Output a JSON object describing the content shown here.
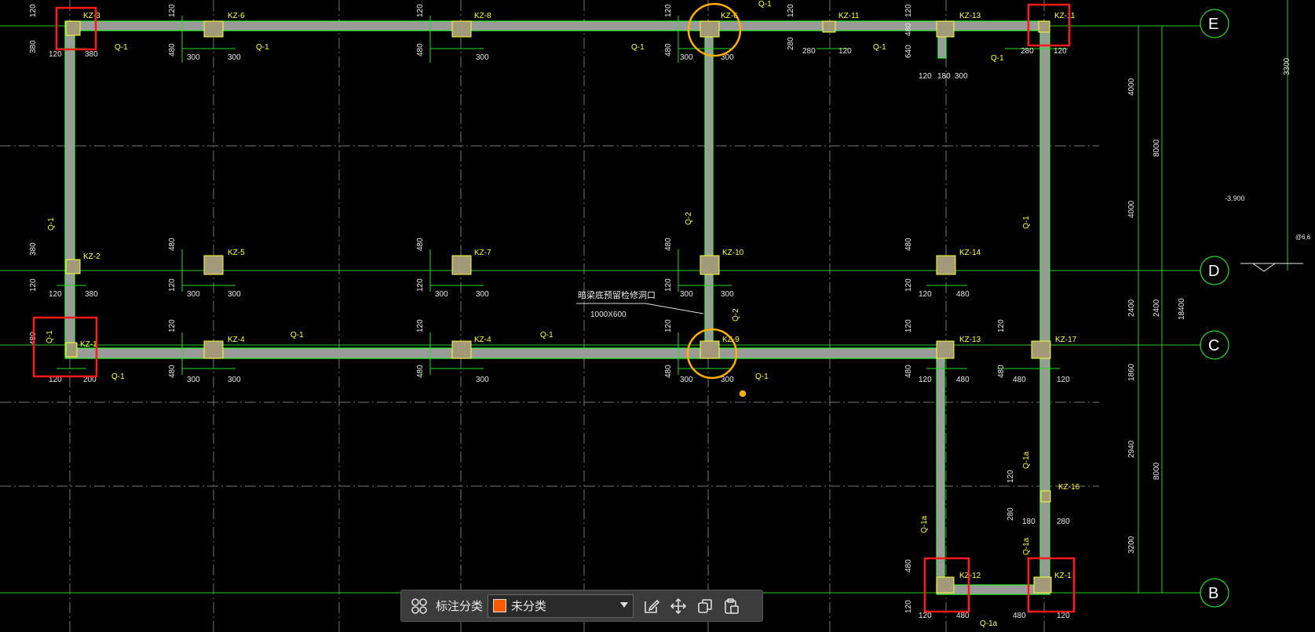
{
  "colors": {
    "background": "#000000",
    "wall": "#9a9a9a",
    "wall_edge": "#33ff33",
    "axis": "#ffffff",
    "dimension": "#22dd22",
    "label": "#ffff33",
    "column_fill": "#a39a7a",
    "highlight_red": "#ff1a1a",
    "highlight_orange": "#ffb000",
    "category_swatch": "#ff5a00"
  },
  "axes": {
    "E": "E",
    "D": "D",
    "C": "C",
    "B": "B"
  },
  "columns": {
    "kz1": "KZ-1",
    "kz2": "KZ-2",
    "kz3": "KZ-3",
    "kz4a": "KZ-4",
    "kz4b": "KZ-4",
    "kz5": "KZ-5",
    "kz6a": "KZ-6",
    "kz6b": "KZ-6",
    "kz7": "KZ-7",
    "kz8": "KZ-8",
    "kz9": "KZ-9",
    "kz10": "KZ-10",
    "kz11a": "KZ-11",
    "kz11b": "KZ-11",
    "kz12": "KZ-12",
    "kz13a": "KZ-13",
    "kz13b": "KZ-13",
    "kz14": "KZ-14",
    "kz16": "KZ-16",
    "kz17": "KZ-17",
    "kz1x": "KZ-1"
  },
  "walls": {
    "q1": "Q-1",
    "q2": "Q-2",
    "q1a": "Q-1a"
  },
  "dims": {
    "d120": "120",
    "d380": "380",
    "d480": "480",
    "d300": "300",
    "d280": "280",
    "d180": "180",
    "d640": "640",
    "d200": "200",
    "d4000": "4000",
    "d8000": "8000",
    "d2400": "2400",
    "d1860": "1860",
    "d2940": "2940",
    "d3200": "3200",
    "d18400": "18400",
    "d3300": "3300"
  },
  "annotations": {
    "opening_note": "暗梁底预留检修洞口",
    "opening_size": "1000X600",
    "elevation": "-3.900",
    "side_fragment": "@6,6"
  },
  "toolbar": {
    "category_label": "标注分类",
    "category_value": "未分类"
  }
}
